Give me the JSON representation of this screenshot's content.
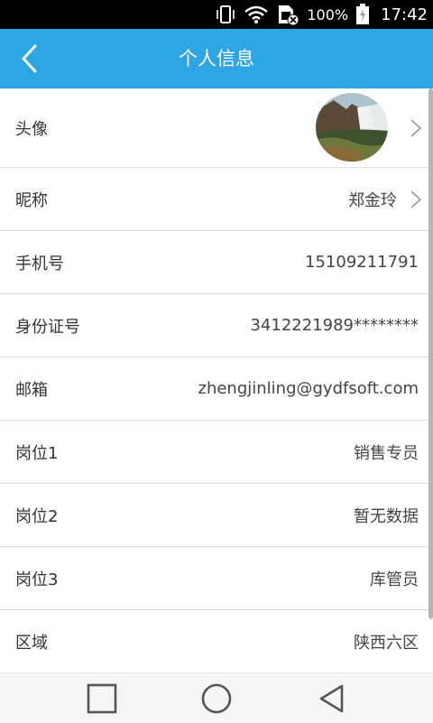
{
  "status_bar": {
    "battery": "100%",
    "time": "17:42",
    "icons": [
      "vibrate-icon",
      "wifi-icon",
      "sim-icon",
      "battery-icon"
    ]
  },
  "header": {
    "title": "个人信息",
    "back_icon": "chevron-left-icon",
    "background": "#2da6e3"
  },
  "rows": [
    {
      "label": "头像",
      "value": "",
      "type": "avatar",
      "chevron": true
    },
    {
      "label": "昵称",
      "value": "郑金玲",
      "chevron": true
    },
    {
      "label": "手机号",
      "value": "15109211791",
      "chevron": false
    },
    {
      "label": "身份证号",
      "value": "3412221989********",
      "chevron": false
    },
    {
      "label": "邮箱",
      "value": "zhengjinling@gydfsoft.com",
      "chevron": false
    },
    {
      "label": "岗位1",
      "value": "销售专员",
      "chevron": false
    },
    {
      "label": "岗位2",
      "value": "暂无数据",
      "chevron": false
    },
    {
      "label": "岗位3",
      "value": "库管员",
      "chevron": false
    },
    {
      "label": "区域",
      "value": "陕西六区",
      "chevron": false
    }
  ],
  "nav_bar": {
    "buttons": [
      "recents-icon",
      "home-icon",
      "back-triangle-icon"
    ]
  }
}
